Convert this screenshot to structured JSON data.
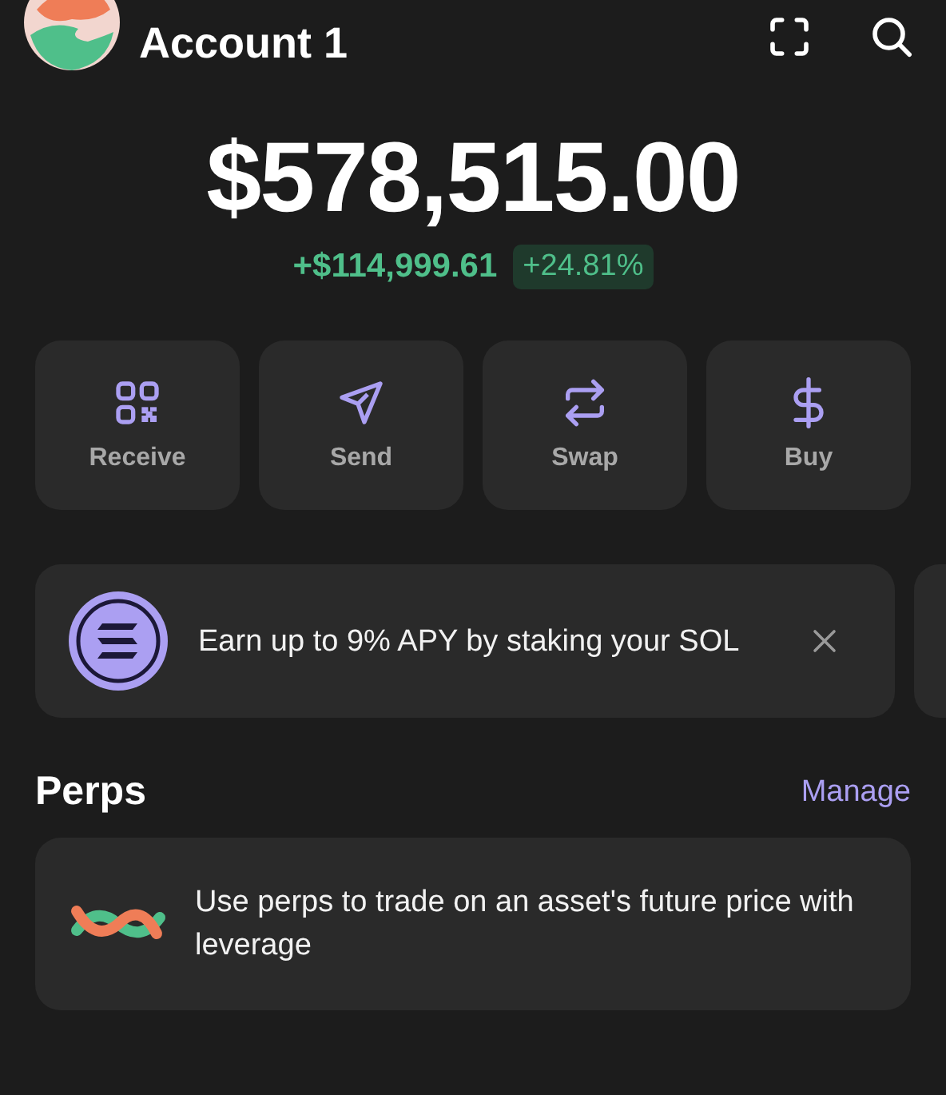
{
  "account": {
    "name": "Account 1"
  },
  "balance": {
    "total": "$578,515.00",
    "change": "+$114,999.61",
    "change_percent": "+24.81%"
  },
  "actions": [
    {
      "kind": "receive",
      "label": "Receive"
    },
    {
      "kind": "send",
      "label": "Send"
    },
    {
      "kind": "swap",
      "label": "Swap"
    },
    {
      "kind": "buy",
      "label": "Buy"
    }
  ],
  "promo": {
    "text": "Earn up to 9% APY by staking your SOL"
  },
  "perps": {
    "title": "Perps",
    "link": "Manage",
    "text": "Use perps to trade on an asset's future price with leverage"
  }
}
